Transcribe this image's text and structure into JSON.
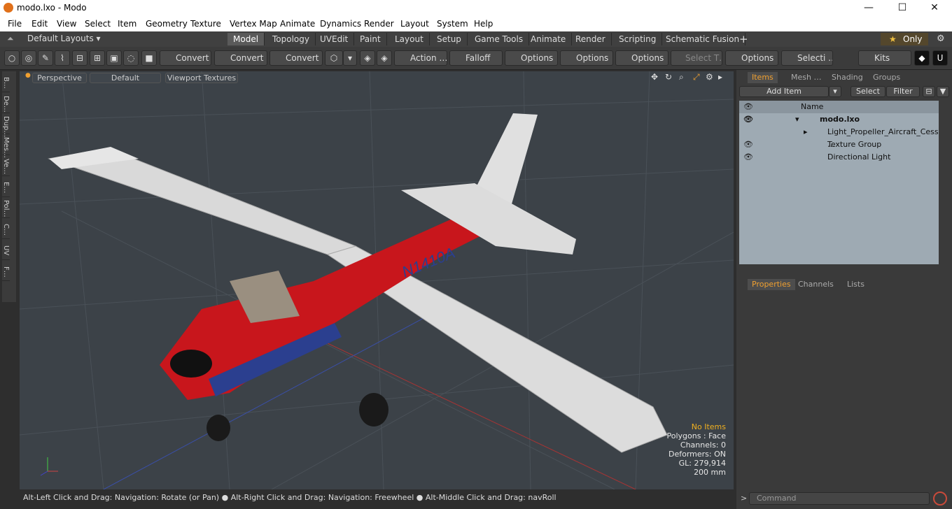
{
  "window": {
    "title": "modo.lxo - Modo",
    "min": "—",
    "max": "☐",
    "close": "✕"
  },
  "menu": [
    "File",
    "Edit",
    "View",
    "Select",
    "Item",
    "Geometry",
    "Texture",
    "Vertex Map",
    "Animate",
    "Dynamics",
    "Render",
    "Layout",
    "System",
    "Help"
  ],
  "layouts_label": "Default Layouts ▾",
  "mode_tabs": [
    "Model",
    "Topology",
    "UVEdit",
    "Paint",
    "Layout",
    "Setup",
    "Game Tools",
    "Animate",
    "Render",
    "Scripting",
    "Schematic Fusion"
  ],
  "only_label": "Only",
  "toolbar": {
    "convert1": "Convert",
    "convert2": "Convert",
    "convert3": "Convert",
    "action": "Action …",
    "falloff": "Falloff",
    "options1": "Options",
    "options2": "Options",
    "options3": "Options",
    "select_t": "Select T…",
    "options4": "Options",
    "selecti": "Selecti …",
    "kits": "Kits"
  },
  "left_tabs": [
    "B…",
    "De…",
    "Dup…",
    "Mes…",
    "Ve…",
    "E…",
    "Pol…",
    "C…",
    "UV",
    "F…"
  ],
  "viewport": {
    "perspective": "Perspective",
    "default": "Default",
    "textures": "Viewport Textures",
    "tail_number": "N1410A"
  },
  "stats": {
    "no_items": "No Items",
    "polygons": "Polygons : Face",
    "channels": "Channels: 0",
    "deformers": "Deformers: ON",
    "gl": "GL: 279,914",
    "scale": "200 mm"
  },
  "status_text": "Alt-Left Click and Drag: Navigation: Rotate (or Pan) ● Alt-Right Click and Drag: Navigation: Freewheel ● Alt-Middle Click and Drag: navRoll",
  "panel": {
    "tabs": [
      "Items",
      "Mesh …",
      "Shading",
      "Groups"
    ],
    "add_item": "Add Item",
    "select": "Select",
    "filter": "Filter",
    "name_header": "Name",
    "tree": [
      {
        "label": "modo.lxo"
      },
      {
        "label": "Light_Propeller_Aircraft_Cess …"
      },
      {
        "label": "Texture Group"
      },
      {
        "label": "Directional Light"
      }
    ],
    "bottom_tabs": [
      "Properties",
      "Channels",
      "Lists"
    ]
  },
  "command_placeholder": "Command",
  "colors": {
    "accent": "#f0a030",
    "viewport": "#3c4248",
    "fuselage": "#c8161c"
  }
}
